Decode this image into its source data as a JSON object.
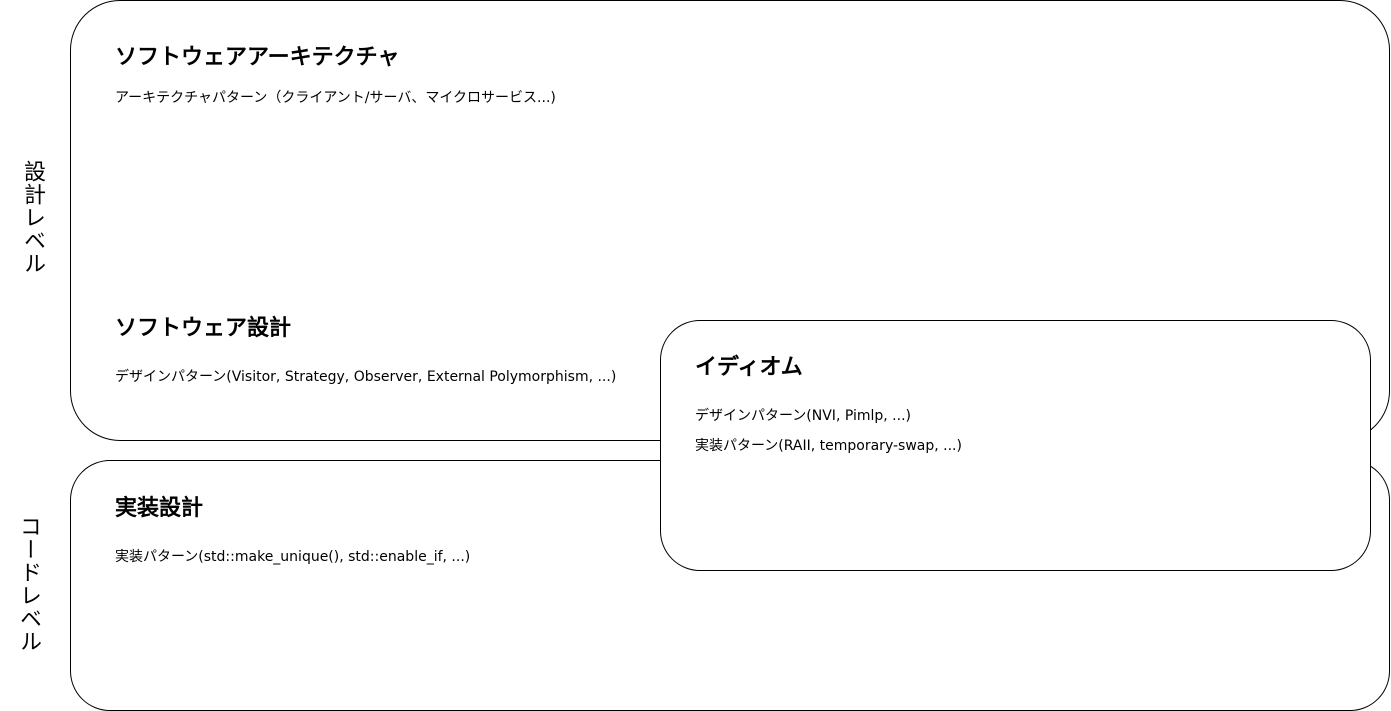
{
  "levels": {
    "design": "設計レベル",
    "code": "コードレベル"
  },
  "architecture": {
    "title": "ソフトウェアアーキテクチャ",
    "description": "アーキテクチャパターン（クライアント/サーバ、マイクロサービス...)"
  },
  "software_design": {
    "title": "ソフトウェア設計",
    "description": "デザインパターン(Visitor, Strategy, Observer, External Polymorphism, ...)"
  },
  "implementation": {
    "title": "実装設計",
    "description": "実装パターン(std::make_unique(), std::enable_if, ...)"
  },
  "idiom": {
    "title": "イディオム",
    "lines": [
      "デザインパターン(NVI, Pimlp, ...)",
      "実装パターン(RAII, temporary-swap, ...)"
    ]
  },
  "colors": {
    "stroke": "#000000",
    "fill": "#ffffff",
    "text": "#000000"
  }
}
